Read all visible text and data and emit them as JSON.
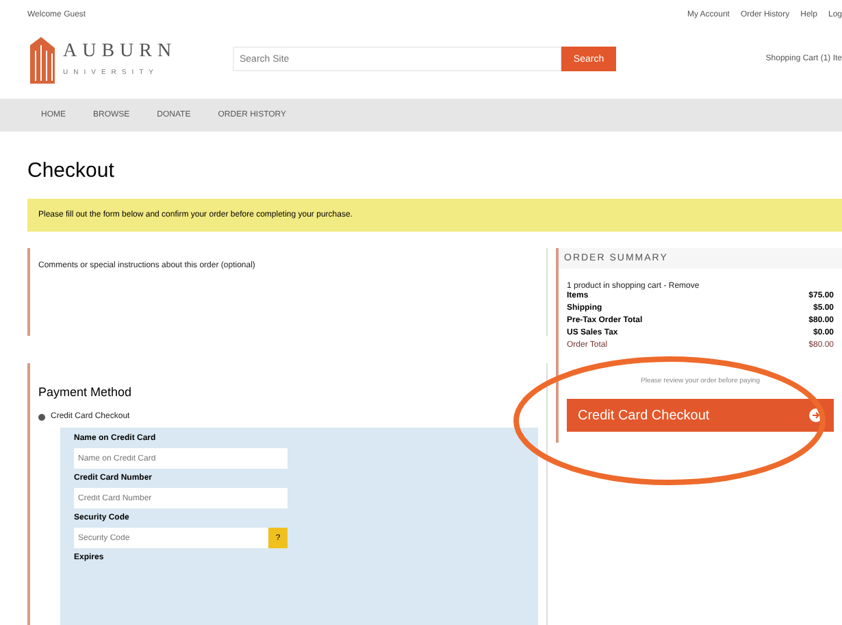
{
  "top_bar": {
    "greeting": "Welcome Guest",
    "links": [
      "My Account",
      "Order History",
      "Help",
      "Log"
    ]
  },
  "header": {
    "logo": {
      "name": "AUBURN",
      "subtitle": "UNIVERSITY"
    },
    "search": {
      "placeholder": "Search Site",
      "button": "Search"
    },
    "cart": "Shopping Cart (1) Ite"
  },
  "nav": [
    "HOME",
    "BROWSE",
    "DONATE",
    "ORDER HISTORY"
  ],
  "page_title": "Checkout",
  "notice": "Please fill out the form below and confirm your order before completing your purchase.",
  "comments": {
    "label": "Comments or special instructions about this order (optional)"
  },
  "order_summary": {
    "title": "ORDER SUMMARY",
    "note": "1 product in shopping cart - Remove",
    "rows": [
      {
        "label": "Items",
        "value": "$75.00",
        "kind": "plain"
      },
      {
        "label": "Shipping",
        "value": "$5.00",
        "kind": "plain"
      },
      {
        "label": "Pre-Tax Order Total",
        "value": "$80.00",
        "kind": "plain"
      },
      {
        "label": "US Sales Tax",
        "value": "$0.00",
        "kind": "plain"
      },
      {
        "label": "Order Total",
        "value": "$80.00",
        "kind": "total"
      }
    ],
    "hint": "Please review your order before paying",
    "button": "Credit Card Checkout",
    "highlighted": true
  },
  "payment": {
    "title": "Payment Method",
    "options": [
      {
        "label": "Credit Card Checkout",
        "selected": true
      }
    ],
    "fields": [
      {
        "label": "Name on Credit Card",
        "placeholder": "Name on Credit Card",
        "kind": "text"
      },
      {
        "label": "Credit Card Number",
        "placeholder": "Credit Card Number",
        "kind": "text"
      },
      {
        "label": "Security Code",
        "placeholder": "Security Code",
        "kind": "help",
        "help": "?"
      },
      {
        "label": "Expires",
        "kind": "label"
      }
    ]
  }
}
